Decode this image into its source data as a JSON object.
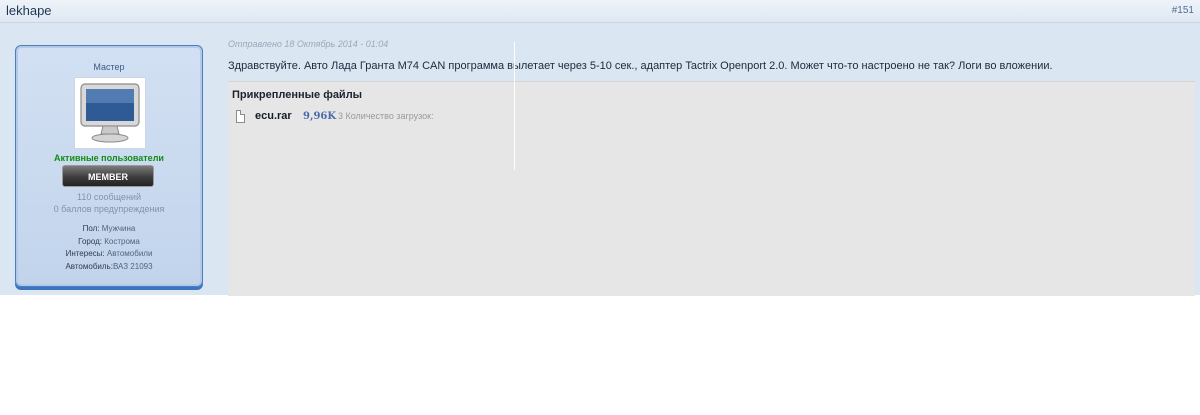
{
  "post": {
    "author_name": "lekhape",
    "post_number": "#151",
    "date": "Отправлено 18 Октябрь 2014 - 01:04",
    "text": "Здравствуйте. Авто Лада Гранта М74 CAN программа вылетает через 5-10 сек., адаптер Tactrix Openport 2.0. Может что-то настроено не так? Логи во вложении."
  },
  "author": {
    "group_title": "Мастер",
    "avatar_icon": "monitor-avatar-icon",
    "group_name": "Активные пользователи",
    "badge": "MEMBER",
    "posts_count": "110 сообщений",
    "warning_points": "0 баллов предупреждения",
    "fields": [
      {
        "label": "Пол:",
        "value": "Мужчина"
      },
      {
        "label": "Город:",
        "value": "Кострома"
      },
      {
        "label": "Интересы:",
        "value": "Автомобили"
      },
      {
        "label": "Автомобиль:",
        "value": "ВАЗ 21093"
      }
    ]
  },
  "attachments": {
    "title": "Прикрепленные файлы",
    "files": [
      {
        "icon": "file-icon",
        "name": "ecu.rar",
        "size": "9,96K",
        "downloads": "3 Количество загрузок:"
      }
    ]
  },
  "colors": {
    "post_background": "#dbe6f3",
    "card_border": "#4a7ec3",
    "group_name": "#138c16",
    "attachment_background": "#e6e6e6"
  }
}
